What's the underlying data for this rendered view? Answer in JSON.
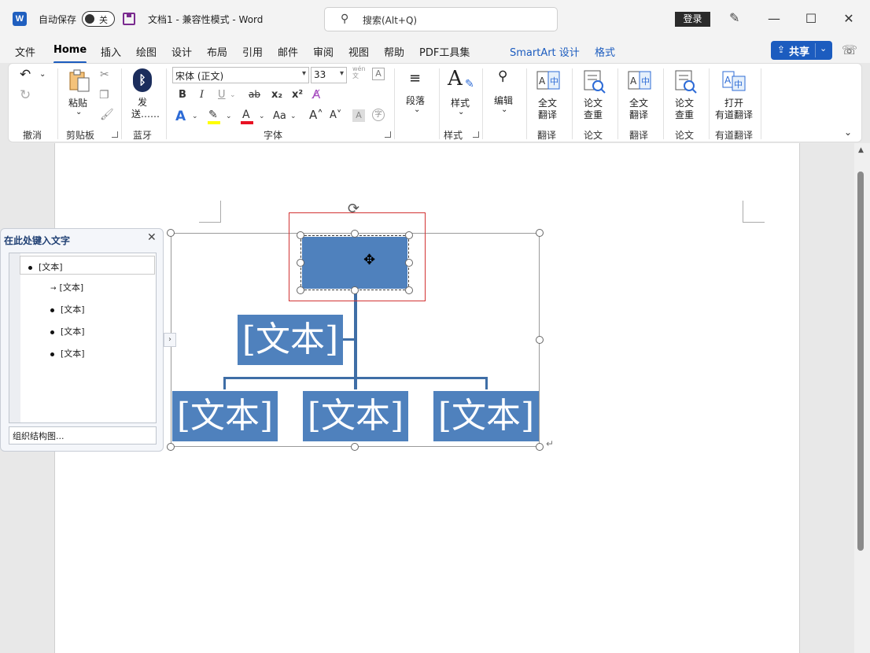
{
  "titlebar": {
    "logo": "W",
    "autosave_label": "自动保存",
    "autosave_state": "关",
    "doc_title": "文档1  -  兼容性模式  -  Word",
    "search_placeholder": "搜索(Alt+Q)",
    "login_label": "登录",
    "minimize": "—",
    "maximize": "☐",
    "close": "✕"
  },
  "tabs": {
    "file": "文件",
    "home": "Home",
    "insert": "插入",
    "draw": "绘图",
    "design": "设计",
    "layout": "布局",
    "references": "引用",
    "mailings": "邮件",
    "review": "审阅",
    "view": "视图",
    "help": "帮助",
    "pdf": "PDF工具集",
    "smartart_design": "SmartArt 设计",
    "format": "格式",
    "share": "共享"
  },
  "ribbon": {
    "undo_group": "撤消",
    "paste": "粘贴",
    "clipboard_group": "剪贴板",
    "send_label_1": "发",
    "send_label_2": "送……",
    "bluetooth_group": "蓝牙",
    "font_name": "宋体 (正文)",
    "font_size": "33",
    "font_group": "字体",
    "paragraph": "段落",
    "styles": "样式",
    "styles_group": "样式",
    "editing": "编辑",
    "full_translate_1": "全文",
    "full_translate_2": "翻译",
    "translate_group": "翻译",
    "paper_check_1": "论文",
    "paper_check_2": "查重",
    "paper_group": "论文",
    "full_translate_b_1": "全文",
    "full_translate_b_2": "翻译",
    "translate_group_b": "翻译",
    "paper_check_b_1": "论文",
    "paper_check_b_2": "查重",
    "paper_group_b": "论文",
    "youdao_1": "打开",
    "youdao_2": "有道翻译",
    "youdao_group": "有道翻译",
    "bold": "B",
    "italic": "I",
    "underline": "U",
    "strike": "ab",
    "subscript": "x₂",
    "superscript": "x²",
    "aa_label": "Aa",
    "wen_label": "wén\n文",
    "grow": "A",
    "shrink": "A"
  },
  "textpane": {
    "title": "在此处键入文字",
    "items": [
      "[文本]",
      "[文本]",
      "[文本]",
      "[文本]",
      "[文本]"
    ],
    "footer": "组织结构图..."
  },
  "smartart": {
    "assistant": "[文本]",
    "child1": "[文本]",
    "child2": "[文本]",
    "child3": "[文本]",
    "node_color": "#4f81bd"
  },
  "colors": {
    "accent": "#1c5cbf",
    "highlight": "#ffff00",
    "font_color": "#e81123"
  }
}
